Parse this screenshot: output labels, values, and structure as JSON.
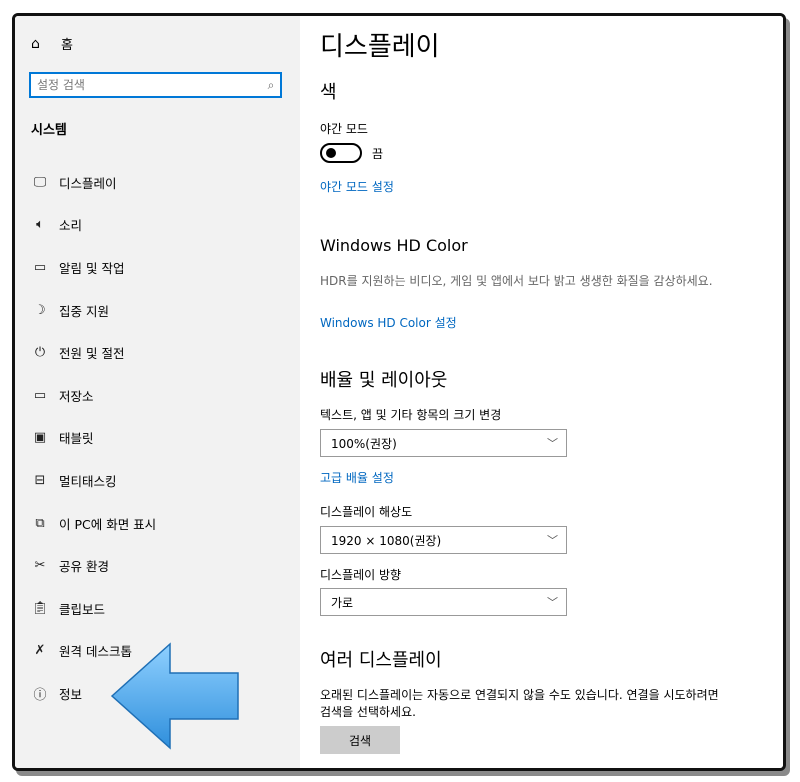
{
  "sidebar": {
    "home_label": "홈",
    "search_placeholder": "설정 검색",
    "section_title": "시스템",
    "items": [
      {
        "label": "디스플레이",
        "icon": "monitor-icon"
      },
      {
        "label": "소리",
        "icon": "speaker-icon"
      },
      {
        "label": "알림 및 작업",
        "icon": "notification-icon"
      },
      {
        "label": "집중 지원",
        "icon": "moon-icon"
      },
      {
        "label": "전원 및 절전",
        "icon": "power-icon"
      },
      {
        "label": "저장소",
        "icon": "storage-icon"
      },
      {
        "label": "태블릿",
        "icon": "tablet-icon"
      },
      {
        "label": "멀티태스킹",
        "icon": "multitasking-icon"
      },
      {
        "label": "이 PC에 화면 표시",
        "icon": "project-icon"
      },
      {
        "label": "공유 환경",
        "icon": "shared-experiences-icon"
      },
      {
        "label": "클립보드",
        "icon": "clipboard-icon"
      },
      {
        "label": "원격 데스크톱",
        "icon": "remote-desktop-icon"
      },
      {
        "label": "정보",
        "icon": "info-icon"
      }
    ]
  },
  "main": {
    "page_title": "디스플레이",
    "color_section": "색",
    "night_mode_label": "야간 모드",
    "night_mode_state": "끔",
    "night_mode_settings_link": "야간 모드 설정",
    "hd_color_title": "Windows HD Color",
    "hd_color_desc": "HDR를 지원하는 비디오, 게임 및 앱에서 보다 밝고 생생한 화질을 감상하세요.",
    "hd_color_link": "Windows HD Color 설정",
    "scale_section": "배율 및 레이아웃",
    "scale_label": "텍스트, 앱 및 기타 항목의 크기 변경",
    "scale_value": "100%(권장)",
    "advanced_scale_link": "고급 배율 설정",
    "resolution_label": "디스플레이 해상도",
    "resolution_value": "1920 × 1080(권장)",
    "orientation_label": "디스플레이 방향",
    "orientation_value": "가로",
    "multi_display_title": "여러 디스플레이",
    "multi_display_desc": "오래된 디스플레이는 자동으로 연결되지 않을 수도 있습니다. 연결을 시도하려면 검색을 선택하세요.",
    "detect_button": "검색"
  },
  "colors": {
    "accent": "#0078d7",
    "link": "#0067c0",
    "sidebar_bg": "#f2f2f2",
    "arrow": "#5ab4f0"
  }
}
